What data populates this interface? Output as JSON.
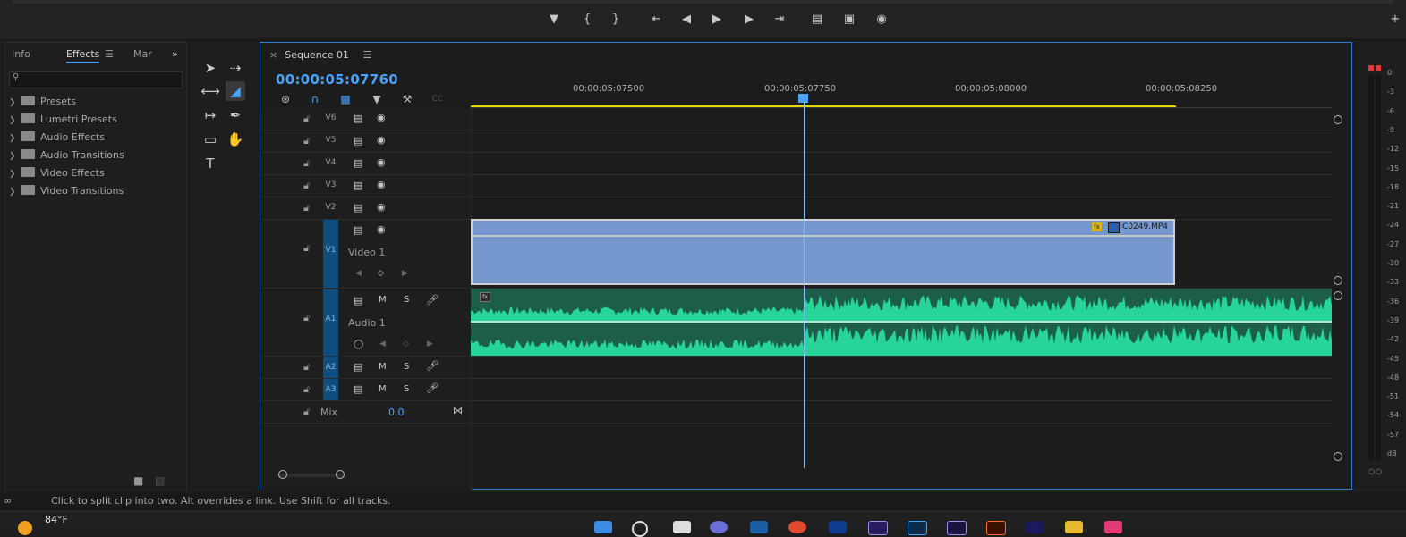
{
  "panel_tabs": {
    "info": "Info",
    "effects": "Effects",
    "markers": "Mar"
  },
  "effects_tree": [
    "Presets",
    "Lumetri Presets",
    "Audio Effects",
    "Audio Transitions",
    "Video Effects",
    "Video Transitions"
  ],
  "sequence": {
    "tab_label": "Sequence 01",
    "timecode": "00:00:05:07760"
  },
  "ruler_labels": [
    "00:00:05:07500",
    "00:00:05:07750",
    "00:00:05:08000",
    "00:00:05:08250"
  ],
  "tracks": {
    "v6": "V6",
    "v5": "V5",
    "v4": "V4",
    "v3": "V3",
    "v2": "V2",
    "v1": "V1",
    "v1_name": "Video 1",
    "a1": "A1",
    "a1_name": "Audio 1",
    "a2": "A2",
    "a3": "A3",
    "mix_label": "Mix",
    "mix_value": "0.0",
    "m": "M",
    "s": "S"
  },
  "clip": {
    "name": "C0249.MP4",
    "fx": "fx"
  },
  "meter_scale": [
    "0",
    "-3",
    "-6",
    "-9",
    "-12",
    "-15",
    "-18",
    "-21",
    "-24",
    "-27",
    "-30",
    "-33",
    "-36",
    "-39",
    "-42",
    "-45",
    "-48",
    "-51",
    "-54",
    "-57",
    "dB"
  ],
  "status_text": "Click to split clip into two. Alt overrides a link. Use Shift for all tracks.",
  "weather": {
    "temp": "84°F"
  },
  "colors": {
    "accent": "#4aa3ff",
    "clip_video": "#7497cd",
    "clip_audio": "#27d49a",
    "workarea": "#e7d500"
  }
}
